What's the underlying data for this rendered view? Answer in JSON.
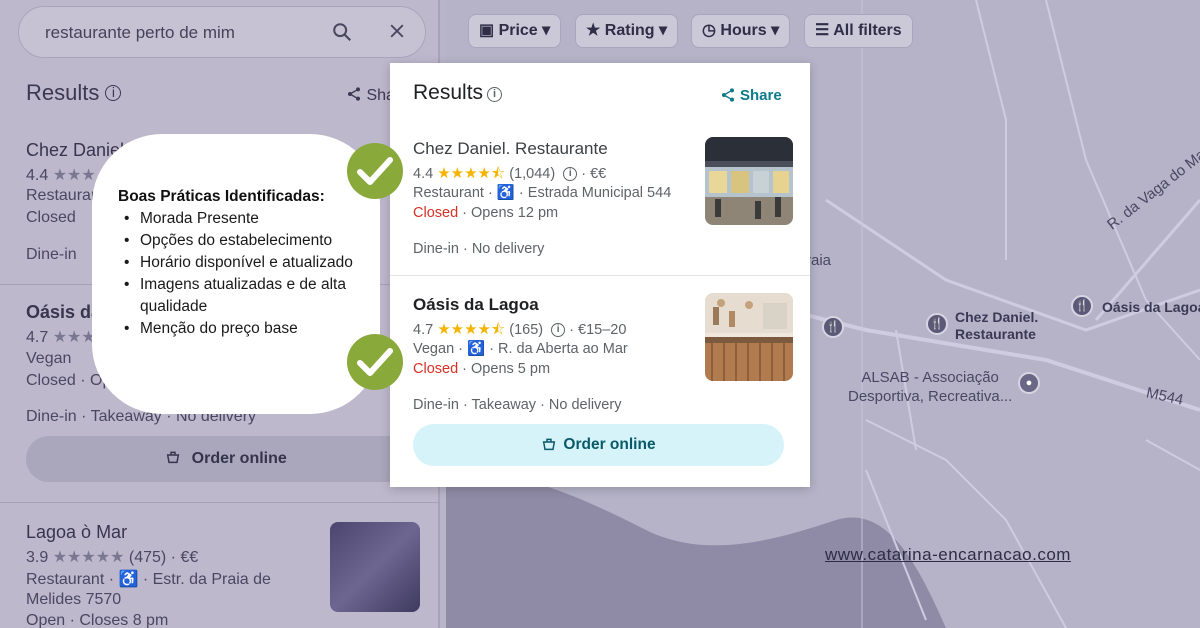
{
  "background_panel": {
    "search_query": "restaurante perto de mim",
    "results_title": "Results",
    "share_label": "Sha",
    "result1": {
      "name": "Chez Daniel",
      "rating": "4.4",
      "type": "Restaurar",
      "status": "Closed"
    },
    "result1_service": "Dine-in",
    "result2": {
      "name": "Oásis da",
      "rating": "4.7",
      "type": "Vegan",
      "status": "Closed · Op"
    },
    "result2_service": "Dine-in · Takeaway · No delivery",
    "order_label": "Order online",
    "result3": {
      "name": "Lagoa ò Mar",
      "rating": "3.9",
      "reviews": "(475)",
      "price": "€€",
      "type": "Restaurant",
      "address": "Estr. da Praia de",
      "address2": "Melides 7570",
      "status": "Open · Closes 8 pm"
    }
  },
  "filters": [
    {
      "label": "Price",
      "icon": "price-tag-icon"
    },
    {
      "label": "Rating",
      "icon": "star-icon"
    },
    {
      "label": "Hours",
      "icon": "clock-icon"
    },
    {
      "label": "All filters",
      "icon": "sliders-icon"
    }
  ],
  "map": {
    "labels": {
      "chez_daniel": [
        "Chez Daniel.",
        "Restaurante"
      ],
      "oasis": "Oásis da Lagoa",
      "road_vaga": "R. da Vaga do Mar",
      "alsab": [
        "ALSAB - Associação",
        "Desportiva, Recreativa..."
      ],
      "m544": "M544",
      "praia": "raia"
    }
  },
  "card": {
    "title": "Results",
    "share_label": "Share",
    "results": [
      {
        "name": "Chez Daniel. Restaurante",
        "rating": "4.4",
        "reviews": "(1,044)",
        "price": "€€",
        "type": "Restaurant",
        "address": "Estrada Municipal 544",
        "status": "Closed",
        "opens": "Opens 12 pm",
        "services": "Dine-in · No delivery"
      },
      {
        "name": "Oásis da Lagoa",
        "rating": "4.7",
        "reviews": "(165)",
        "price": "€15–20",
        "type": "Vegan",
        "address": "R. da Aberta ao Mar",
        "status": "Closed",
        "opens": "Opens 5 pm",
        "services": "Dine-in · Takeaway · No delivery"
      }
    ],
    "order_label": "Order online"
  },
  "annotation": {
    "title": "Boas Práticas Identificadas:",
    "items": [
      "Morada Presente",
      "Opções do estabelecimento",
      "Horário disponível e atualizado",
      "Imagens atualizadas e de alta qualidade",
      "Menção do preço base"
    ]
  },
  "website": "www.catarina-encarnacao.com",
  "colors": {
    "accent_teal": "#0b7a8b",
    "closed_red": "#d93025",
    "star_yellow": "#f4b400",
    "check_green": "#89a93a",
    "order_button_bg": "#d6f3fa"
  }
}
